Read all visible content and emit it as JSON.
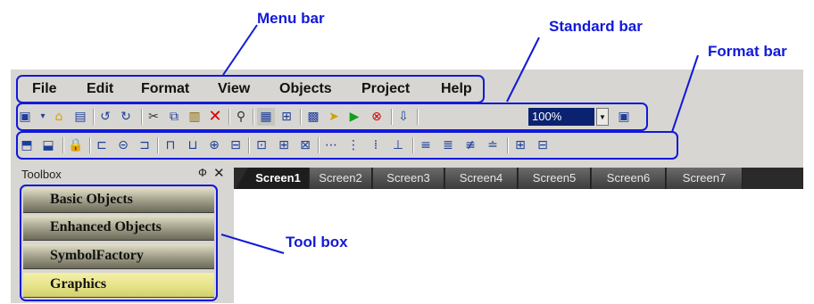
{
  "annotations": {
    "menu_bar": "Menu bar",
    "standard_bar": "Standard bar",
    "format_bar": "Format bar",
    "tool_box": "Tool box"
  },
  "menu": {
    "items": [
      "File",
      "Edit",
      "Format",
      "View",
      "Objects",
      "Project",
      "Help"
    ]
  },
  "standard_toolbar": {
    "zoom_value": "100%",
    "zoom_dropdown_icon": "chevron-down-icon"
  },
  "toolbox": {
    "title": "Toolbox",
    "pin_glyph": "Ф",
    "close_glyph": "✕",
    "items": [
      "Basic Objects",
      "Enhanced Objects",
      "SymbolFactory",
      "Graphics"
    ],
    "active_item": "Graphics"
  },
  "screen_tabs": {
    "tabs": [
      "Screen1",
      "Screen2",
      "Screen3",
      "Screen4",
      "Screen5",
      "Screen6",
      "Screen7"
    ],
    "active_tab": "Screen1"
  },
  "colors": {
    "annotation_blue": "#1219d8",
    "toolbox_active": "#e6e38a",
    "tab_strip_dark": "#2a2a2a"
  }
}
